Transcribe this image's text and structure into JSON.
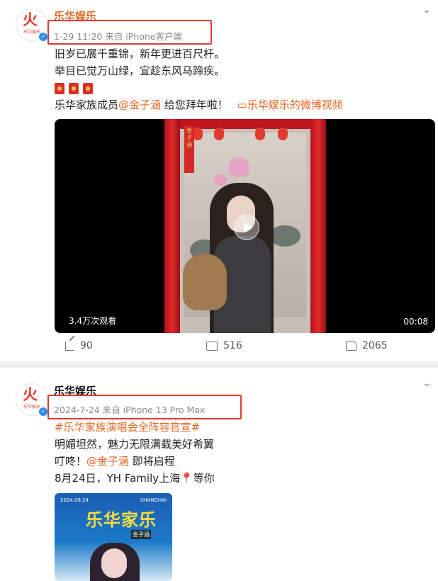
{
  "post1": {
    "username": "乐华娱乐",
    "avatar_label": "乐华娱乐",
    "meta": "1-29 11:20  来自 iPhone客户端",
    "line1": "旧岁已展千重锦，新年更进百尺杆。",
    "line2": "举目已觉万山绿，宜趁东风马蹄疾。",
    "line4_prefix": "乐华家族成员",
    "mention": "@金子涵",
    "line4_suffix": " 给您拜年啦！",
    "video_link_icon": "video-camera-icon",
    "video_link": "乐华娱乐的微博视频",
    "video": {
      "banner_text": "金子涵",
      "views": "3.4万次观看",
      "duration": "00:08"
    },
    "actions": {
      "share_count": "90",
      "comment_count": "516",
      "like_count": "2065"
    }
  },
  "post2": {
    "username": "乐华娱乐",
    "meta": "2024-7-24  来自 iPhone 13 Pro Max",
    "hashtag": "#乐华家族演唱会全阵容官宣#",
    "line2": "明媚坦然，魅力无限满载美好希翼",
    "line3_prefix": "叮咚！",
    "mention": "@金子涵",
    "line3_suffix": " 即将启程",
    "line4": "8月24日，YH Family上海",
    "line4_suffix": "等你",
    "poster": {
      "date": "2024.08.24",
      "city": "SHANGHAI",
      "title": "乐华家乐",
      "name": "金子涵"
    }
  },
  "colors": {
    "accent": "#e8661f",
    "highlight_box": "#e53935",
    "brand_red": "#e53a2c",
    "meta_gray": "#8a8a8a"
  }
}
